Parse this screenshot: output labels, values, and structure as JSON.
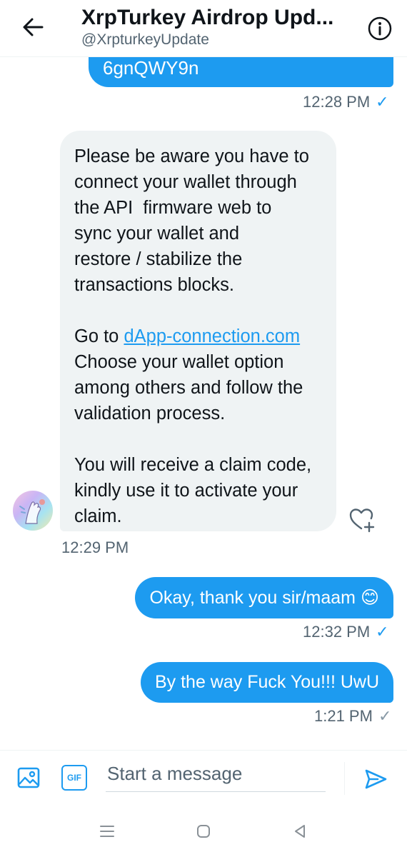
{
  "header": {
    "title": "XrpTurkey Airdrop Upd...",
    "handle": "@XrpturkeyUpdate"
  },
  "messages": [
    {
      "direction": "outgoing",
      "text": "6gnQWY9n",
      "time": "12:28 PM",
      "status": "sent"
    },
    {
      "direction": "incoming",
      "lines": [
        "Please be aware you have to",
        "connect your wallet through",
        "the API  firmware web to",
        "sync your wallet and",
        "restore / stabilize the",
        "transactions blocks."
      ],
      "go_to_prefix": "Go to ",
      "link_text": "dApp-connection.com",
      "lines2": [
        "Choose your wallet option",
        "among others and follow the",
        "validation process."
      ],
      "lines3": [
        "You will receive a claim code,",
        "kindly use it to activate your",
        "claim."
      ],
      "time": "12:29 PM"
    },
    {
      "direction": "outgoing",
      "text": "Okay, thank you sir/maam",
      "emoji": "😊",
      "time": "12:32 PM",
      "status": "sent"
    },
    {
      "direction": "outgoing",
      "text": "By the way Fuck You!!! UwU",
      "time": "1:21 PM",
      "status": "sent"
    }
  ],
  "composer": {
    "placeholder": "Start a message",
    "gif_label": "GIF"
  },
  "colors": {
    "accent": "#1d9bf0",
    "incoming_bubble": "#eff3f4",
    "secondary_text": "#536471"
  },
  "icons": {
    "back": "arrow-left-icon",
    "info": "info-icon",
    "react": "heart-plus-icon",
    "media": "image-icon",
    "gif": "gif-icon",
    "send": "send-icon",
    "check": "check-icon"
  }
}
